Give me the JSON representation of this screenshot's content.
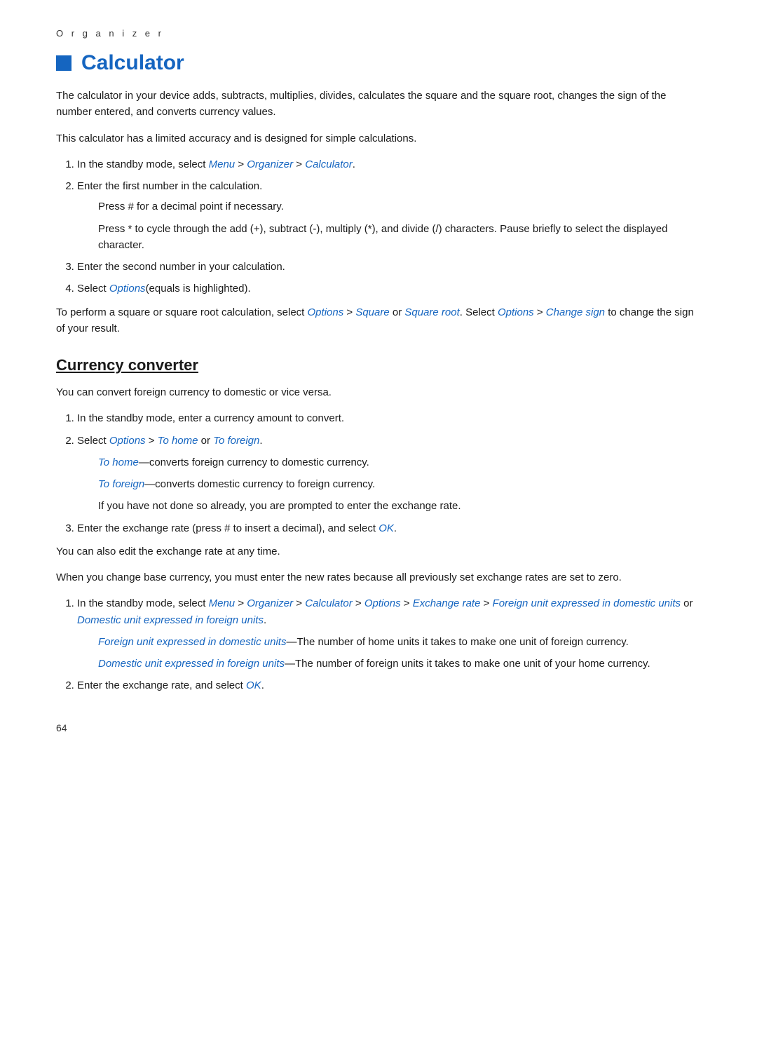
{
  "header": {
    "label": "O r g a n i z e r"
  },
  "title": {
    "text": "Calculator"
  },
  "intro": {
    "para1": "The calculator in your device adds, subtracts, multiplies, divides, calculates the square and the square root, changes the sign of the number entered, and converts currency values.",
    "para2": "This calculator has a limited accuracy and is designed for simple calculations."
  },
  "steps_main": [
    {
      "id": 1,
      "text_before": "In the standby mode, select ",
      "link1": "Menu",
      "sep1": " > ",
      "link2": "Organizer",
      "sep2": " > ",
      "link3": "Calculator",
      "text_after": "."
    },
    {
      "id": 2,
      "text": "Enter the first number in the calculation."
    },
    {
      "id": 3,
      "text": "Enter the second number in your calculation."
    },
    {
      "id": 4,
      "text_before": "Select ",
      "link": "Options",
      "text_after": "(equals is highlighted)."
    }
  ],
  "indent_step2_a": "Press # for a decimal point if necessary.",
  "indent_step2_b": "Press * to cycle through the add (+), subtract (-), multiply (*), and divide (/) characters. Pause briefly to select the displayed character.",
  "square_para": {
    "text_before": "To perform a square or square root calculation, select ",
    "link1": "Options",
    "sep1": " > ",
    "link2": "Square",
    "text_mid1": " or ",
    "link3": "Square root",
    "text_mid2": ". Select ",
    "link4": "Options",
    "sep2": " > ",
    "link5": "Change sign",
    "text_after": " to change the sign of your result."
  },
  "currency_section": {
    "title": "Currency converter",
    "intro": "You can convert foreign currency to domestic or vice versa.",
    "steps": [
      {
        "id": 1,
        "text": "In the standby mode, enter a currency amount to convert."
      },
      {
        "id": 2,
        "text_before": "Select ",
        "link1": "Options",
        "sep1": " > ",
        "link2": "To home",
        "text_mid": " or ",
        "link3": "To foreign",
        "text_after": "."
      },
      {
        "id": 3,
        "text_before": "Enter the exchange rate (press # to insert a decimal), and select ",
        "link": "OK",
        "text_after": "."
      }
    ],
    "indent_tohome": {
      "link": "To home",
      "text": "—converts foreign currency to domestic currency."
    },
    "indent_toforeign": {
      "link": "To foreign",
      "text": "—converts domestic currency to foreign currency."
    },
    "indent_prompt": "If you have not done so already, you are prompted to enter the exchange rate.",
    "para_edit": "You can also edit the exchange rate at any time.",
    "para_change": "When you change base currency, you must enter the new rates because all previously set exchange rates are set to zero.",
    "steps2": [
      {
        "id": 1,
        "text_before": "In the standby mode, select ",
        "link1": "Menu",
        "sep1": " > ",
        "link2": "Organizer",
        "sep2": " > ",
        "link3": "Calculator",
        "sep3": " > ",
        "link4": "Options",
        "sep4": " > ",
        "link5": "Exchange rate",
        "sep5": " > ",
        "link6": "Foreign unit expressed in domestic units",
        "text_mid": " or ",
        "link7": "Domestic unit expressed in foreign units",
        "text_after": "."
      },
      {
        "id": 2,
        "text_before": "Enter the exchange rate, and select ",
        "link": "OK",
        "text_after": "."
      }
    ],
    "indent_foreign_expressed": {
      "link": "Foreign unit expressed in domestic units",
      "text": "—The number of home units it takes to make one unit of foreign currency."
    },
    "indent_domestic_expressed": {
      "link": "Domestic unit expressed in foreign units",
      "text": "—The number of foreign units it takes to make one unit of your home currency."
    }
  },
  "page_number": "64"
}
